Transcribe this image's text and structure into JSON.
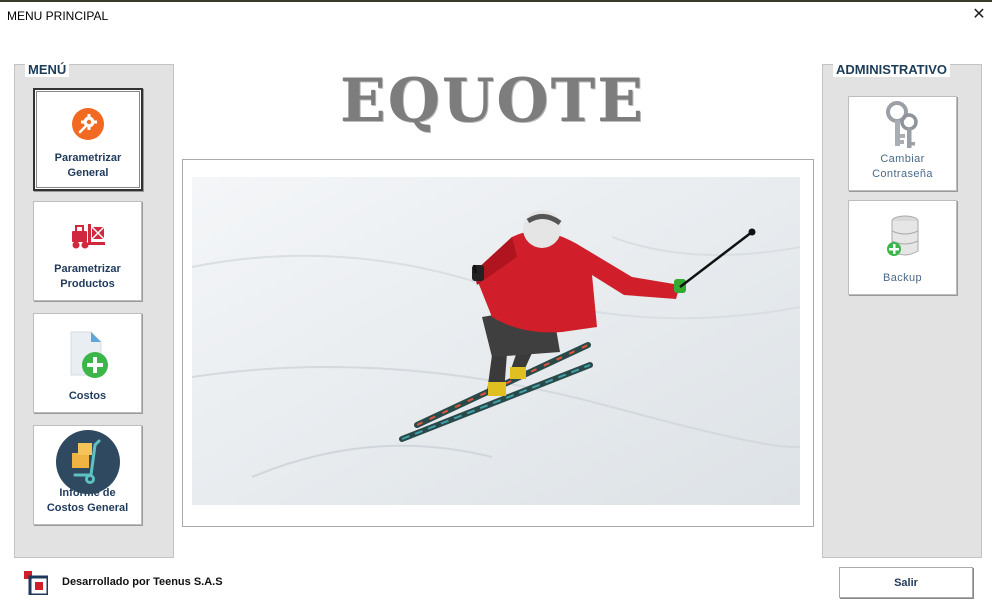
{
  "window": {
    "title": "MENU PRINCIPAL",
    "close_glyph": "✕"
  },
  "menu": {
    "legend": "MENÚ",
    "items": [
      {
        "line1": "Parametrizar",
        "line2": "General",
        "icon": "gear-icon",
        "color": "#f26a21"
      },
      {
        "line1": "Parametrizar",
        "line2": "Productos",
        "icon": "forklift-icon",
        "color": "#d0283c"
      },
      {
        "line1": "Costos",
        "line2": "",
        "icon": "add-document-icon",
        "color": "#3cb64a"
      },
      {
        "line1": "Informe de",
        "line2": "Costos General",
        "icon": "hand-truck-icon",
        "color": "#2f4a60"
      }
    ]
  },
  "admin": {
    "legend": "ADMINISTRATIVO",
    "items": [
      {
        "line1": "Cambiar",
        "line2": "Contraseña",
        "icon": "keys-icon"
      },
      {
        "line1": "Backup",
        "line2": "",
        "icon": "database-add-icon"
      }
    ]
  },
  "brand": {
    "name": "EQUOTE"
  },
  "footer": {
    "developer": "Desarrollado por Teenus S.A.S",
    "exit_label": "Salir"
  },
  "colors": {
    "accent": "#1f3a5c",
    "panel": "#e2e2e2",
    "brand_text": "#7d7d7d"
  }
}
